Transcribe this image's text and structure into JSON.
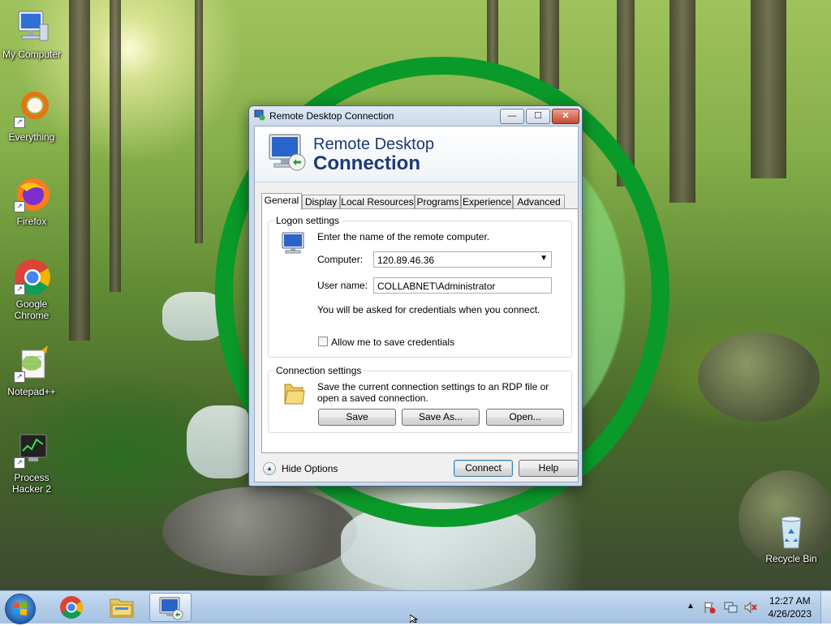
{
  "desktop": {
    "icons": [
      {
        "label": "My Computer",
        "icon": "computer-icon"
      },
      {
        "label": "Everything",
        "icon": "everything-search-icon"
      },
      {
        "label": "Firefox",
        "icon": "firefox-icon"
      },
      {
        "label": "Google Chrome",
        "icon": "chrome-icon"
      },
      {
        "label": "Notepad++",
        "icon": "notepadpp-icon"
      },
      {
        "label": "Process Hacker 2",
        "icon": "process-hacker-icon"
      },
      {
        "label": "Recycle Bin",
        "icon": "recycle-bin-icon"
      }
    ]
  },
  "window": {
    "title": "Remote Desktop Connection",
    "banner_line1": "Remote Desktop",
    "banner_line2": "Connection",
    "controls": {
      "minimize": "—",
      "maximize": "☐",
      "close": "✕"
    },
    "tabs": [
      "General",
      "Display",
      "Local Resources",
      "Programs",
      "Experience",
      "Advanced"
    ],
    "active_tab": "General",
    "logon": {
      "legend": "Logon settings",
      "prompt": "Enter the name of the remote computer.",
      "computer_label": "Computer:",
      "computer_value": "120.89.46.36",
      "username_label": "User name:",
      "username_value": "COLLABNET\\Administrator",
      "credentials_note": "You will be asked for credentials when you connect.",
      "save_credentials_label": "Allow me to save credentials",
      "save_credentials_checked": false
    },
    "connection": {
      "legend": "Connection settings",
      "description": "Save the current connection settings to an RDP file or open a saved connection.",
      "save_button": "Save",
      "save_as_button": "Save As...",
      "open_button": "Open..."
    },
    "hide_options": "Hide Options",
    "connect_button": "Connect",
    "help_button": "Help"
  },
  "taskbar": {
    "time": "12:27 AM",
    "date": "4/26/2023",
    "pinned": [
      "windows-explorer-icon",
      "chrome-icon",
      "file-explorer-icon",
      "remote-desktop-icon"
    ]
  },
  "colors": {
    "accent_green": "#0a9a2a",
    "banner_text": "#1b3a78",
    "taskbar": "#b4cde8"
  }
}
